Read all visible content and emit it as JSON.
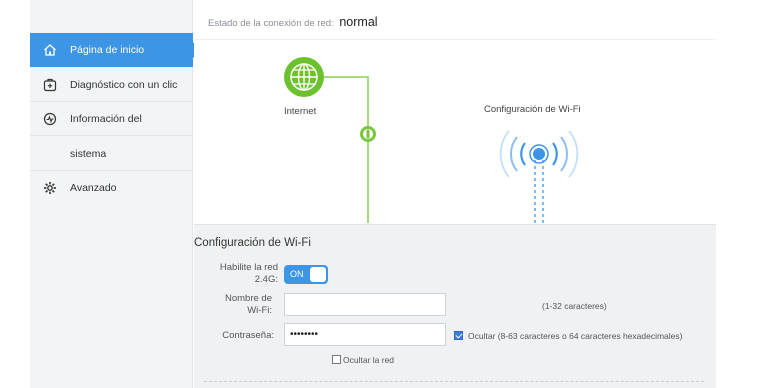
{
  "sidebar": {
    "items": [
      {
        "label": "Página de inicio",
        "icon": "home-icon",
        "active": true
      },
      {
        "label": "Diagnóstico con un clic",
        "icon": "diagnostic-icon"
      },
      {
        "label": "Información del",
        "icon": "system-info-icon"
      },
      {
        "label": "sistema"
      },
      {
        "label": "Avanzado",
        "icon": "gear-icon"
      }
    ]
  },
  "status": {
    "label": "Estado de la conexión de red:",
    "value": "normal"
  },
  "diagram": {
    "internet_label": "Internet",
    "wifi_label": "Configuración de Wi-Fi",
    "internet_color": "#6cc12f",
    "wifi_color": "#3d95e6"
  },
  "wifi_form": {
    "title": "Configuración de Wi-Fi",
    "enable_label_1": "Habilite la red",
    "enable_label_2": "2.4G:",
    "toggle_label": "ON",
    "name_label_1": "Nombre de",
    "name_label_2": "Wi-Fi:",
    "name_value": "",
    "name_hint": "(1-32 caracteres)",
    "password_label": "Contraseña:",
    "password_value": "••••••••",
    "hide_password_label": "Ocultar (8-63 caracteres o 64 caracteres hexadecimales)",
    "hide_network_label": "Ocultar la red"
  },
  "colors": {
    "accent": "#3d95e6",
    "green": "#6cc12f"
  }
}
